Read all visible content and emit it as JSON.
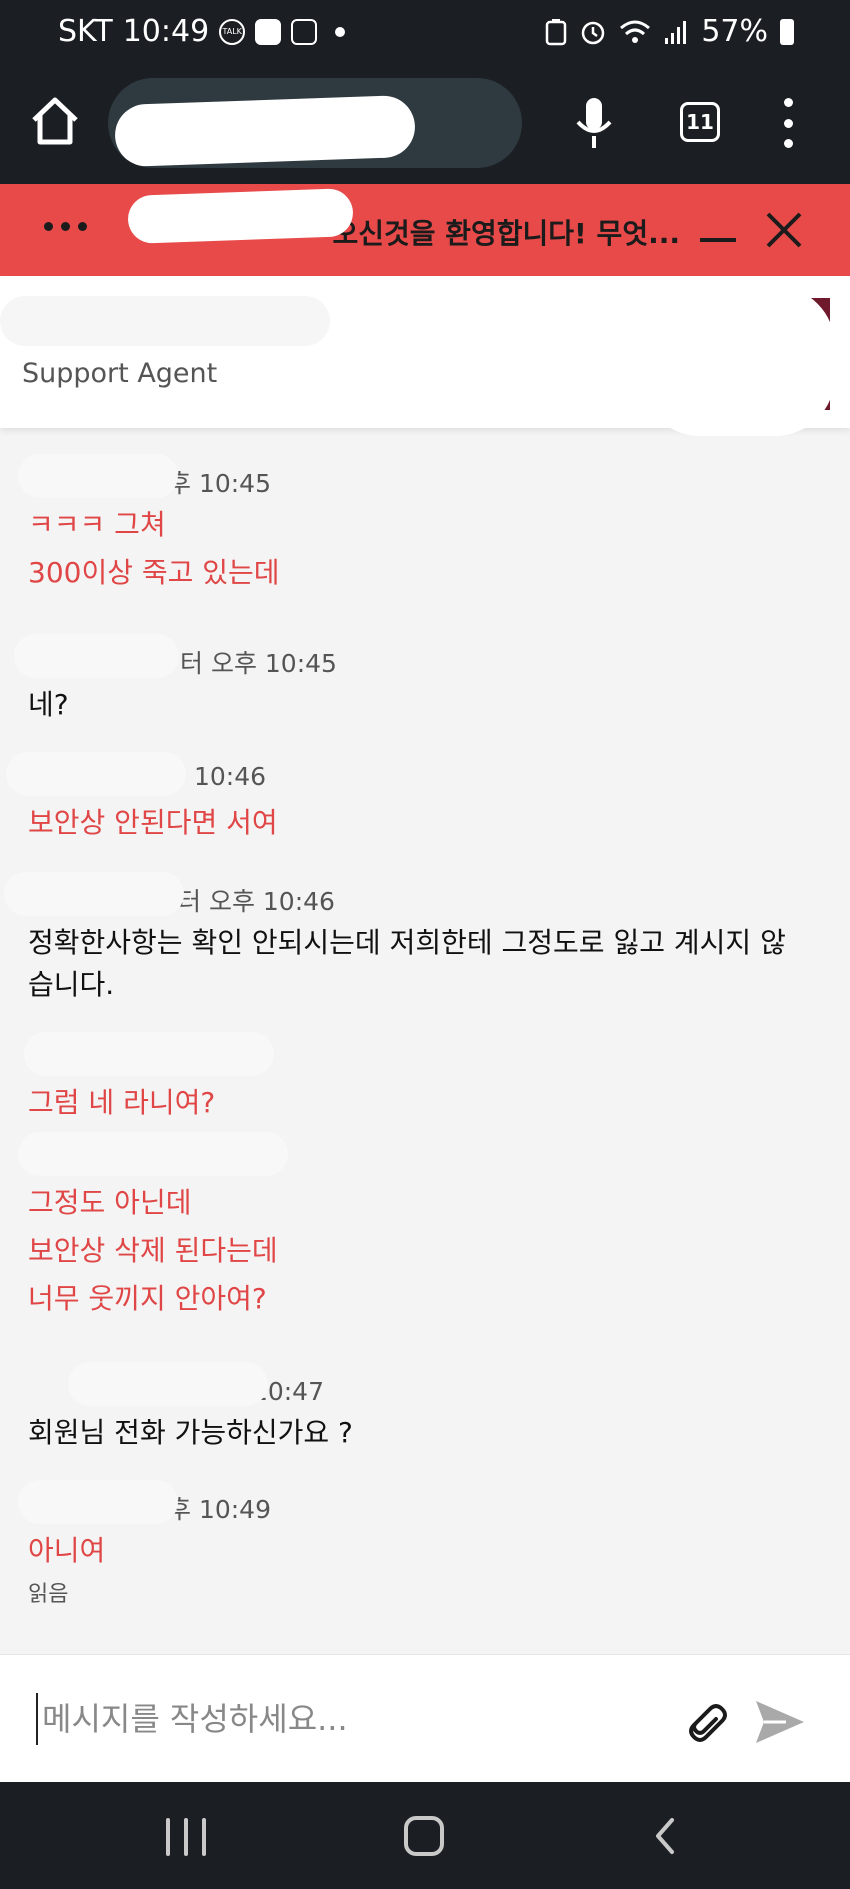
{
  "status_bar": {
    "carrier": "SKT",
    "time": "10:49",
    "notif_icons": [
      "talk-icon",
      "message-icon",
      "instagram-icon"
    ],
    "battery": "57%"
  },
  "browser": {
    "tab_count": "11"
  },
  "chat_header": {
    "title": "오신것을 환영합니다! 무엇..."
  },
  "agent": {
    "role": "Support Agent"
  },
  "messages": [
    {
      "meta": "후 10:45",
      "sender": "user",
      "lines": [
        "ㅋㅋㅋ 그쳐",
        "300이상 죽고 있는데"
      ]
    },
    {
      "meta": "터 오후 10:45",
      "sender": "agent",
      "lines": [
        "네?"
      ]
    },
    {
      "meta": "10:46",
      "sender": "user",
      "lines": [
        "보안상 안된다면 서여"
      ]
    },
    {
      "meta": "터 오후 10:46",
      "sender": "agent",
      "lines": [
        "정확한사항는 확인 안되시는데 저희한테 그정도로 잃고 계시지 않습니다."
      ]
    },
    {
      "meta": "",
      "sender": "user",
      "lines": [
        "그럼 네 라니여?"
      ]
    },
    {
      "meta": "",
      "sender": "user",
      "lines": [
        "그정도 아닌데",
        "보안상 삭제 된다는데",
        "너무 웃끼지 안아여?"
      ]
    },
    {
      "meta": "오후 10:47",
      "sender": "agent",
      "lines": [
        "회원님 전화 가능하신가요 ?"
      ]
    },
    {
      "meta": "후 10:49",
      "sender": "user",
      "lines": [
        "아니여"
      ],
      "status": "읽음"
    }
  ],
  "composer": {
    "placeholder": "메시지를 작성하세요..."
  },
  "colors": {
    "header": "#e84a4a",
    "user_text": "#e04646",
    "dark_bar": "#1b1f23"
  }
}
